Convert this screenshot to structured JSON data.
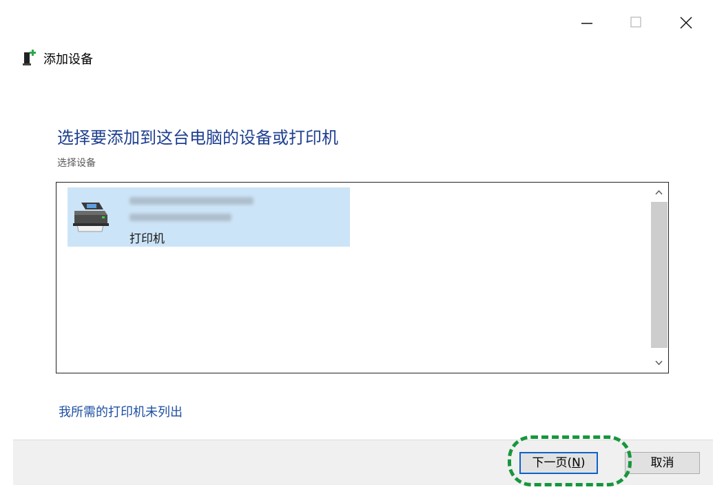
{
  "window": {
    "title": "添加设备",
    "controls": {
      "minimize_icon": "minimize-icon",
      "maximize_icon": "maximize-icon",
      "close_icon": "close-icon"
    }
  },
  "main": {
    "heading": "选择要添加到这台电脑的设备或打印机",
    "sub_label": "选择设备",
    "devices": [
      {
        "type": "打印机",
        "icon": "printer-icon",
        "selected": true
      }
    ],
    "missing_link": "我所需的打印机未列出"
  },
  "footer": {
    "next_label": "下一页(",
    "next_accel": "N",
    "next_suffix": ")",
    "cancel_label": "取消"
  },
  "colors": {
    "heading": "#1e3f8f",
    "link": "#1e4fa3",
    "selection": "#cce4f7",
    "highlight": "#17963d"
  }
}
